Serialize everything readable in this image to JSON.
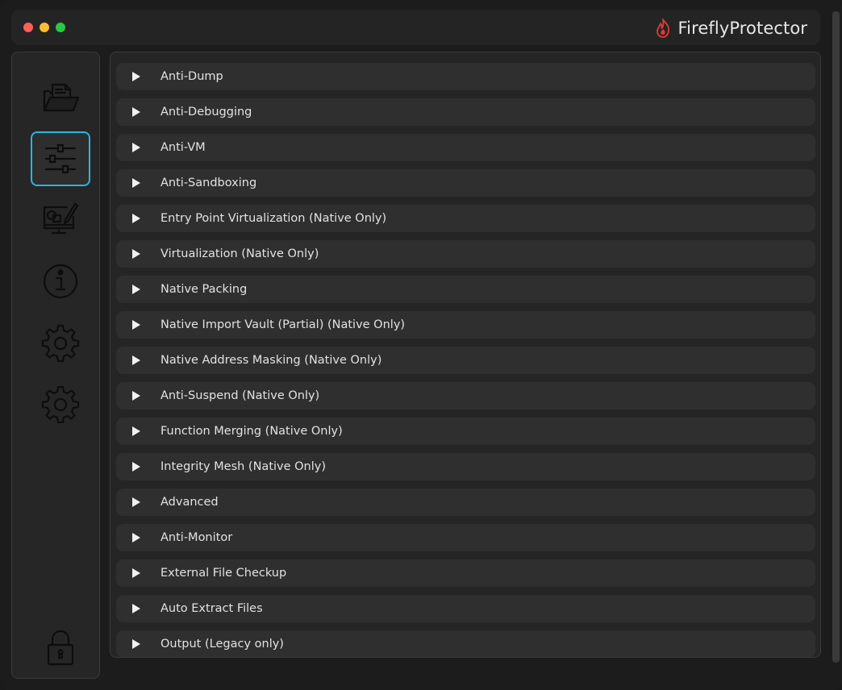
{
  "app": {
    "title": "FireflyProtector",
    "logo_icon": "flame-logo-icon",
    "accent_color": "#29b6e0",
    "logo_color": "#e53935"
  },
  "sidebar": {
    "items": [
      {
        "name": "files",
        "icon": "folder-document-icon",
        "active": false
      },
      {
        "name": "protections",
        "icon": "sliders-icon",
        "active": true
      },
      {
        "name": "design",
        "icon": "monitor-pen-icon",
        "active": false
      },
      {
        "name": "info",
        "icon": "info-icon",
        "active": false
      },
      {
        "name": "settings",
        "icon": "gear-icon",
        "active": false
      },
      {
        "name": "settings-2",
        "icon": "gear-icon",
        "active": false
      }
    ],
    "bottom_icon": "lock-icon"
  },
  "sections": [
    {
      "label": "Anti-Dump"
    },
    {
      "label": "Anti-Debugging"
    },
    {
      "label": "Anti-VM"
    },
    {
      "label": "Anti-Sandboxing"
    },
    {
      "label": "Entry Point Virtualization (Native Only)"
    },
    {
      "label": "Virtualization (Native Only)"
    },
    {
      "label": "Native Packing"
    },
    {
      "label": "Native Import Vault (Partial) (Native Only)"
    },
    {
      "label": "Native Address Masking (Native Only)"
    },
    {
      "label": "Anti-Suspend (Native Only)"
    },
    {
      "label": "Function Merging (Native Only)"
    },
    {
      "label": "Integrity Mesh (Native Only)"
    },
    {
      "label": "Advanced"
    },
    {
      "label": "Anti-Monitor"
    },
    {
      "label": "External File Checkup"
    },
    {
      "label": "Auto Extract Files"
    },
    {
      "label": "Output (Legacy only)"
    }
  ]
}
